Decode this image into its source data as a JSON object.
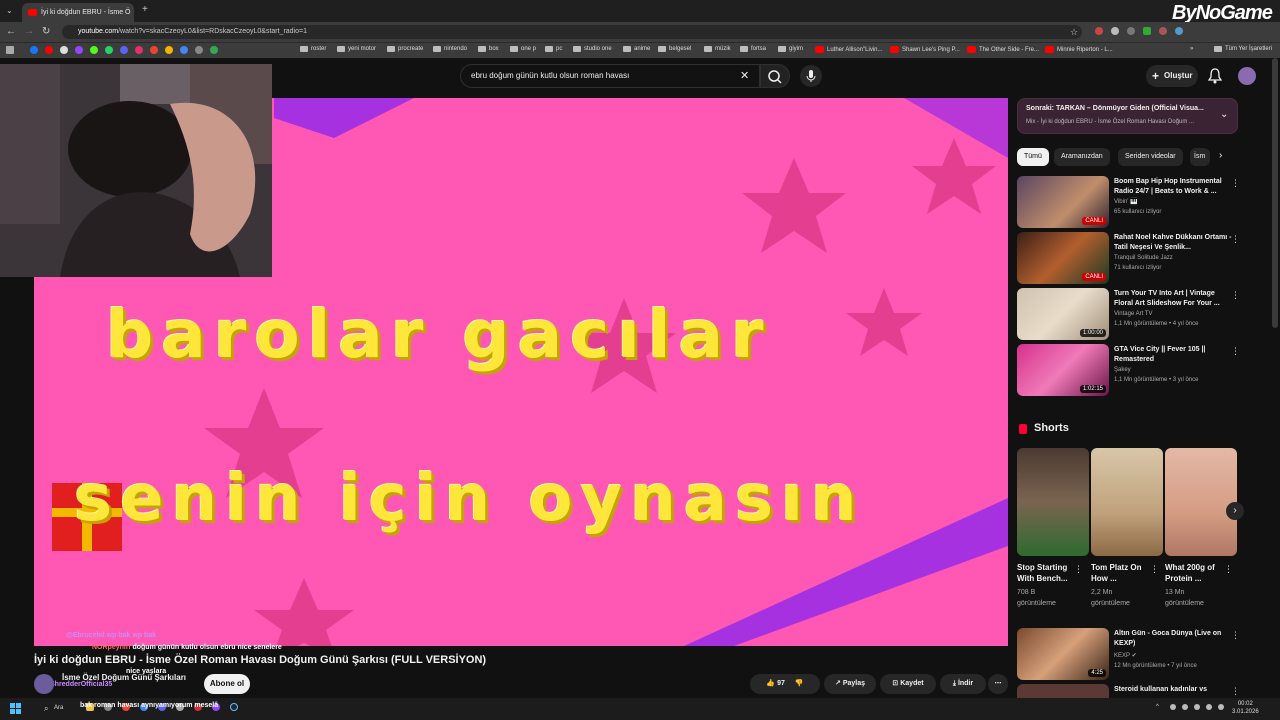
{
  "browser": {
    "tab_title": "İyi ki doğdun EBRU - İsme Ö",
    "url_host": "youtube.com",
    "url_path": "/watch?v=skacCzeoyL0&list=RDskacCzeoyL0&start_radio=1",
    "watermark": "ByNoGame",
    "bookmarks": [
      "roster",
      "yeni motor",
      "procreate",
      "nintendo",
      "box",
      "one p",
      "pc",
      "studio one",
      "anime",
      "belgesel",
      "müzik",
      "fortsa",
      "giyim",
      "Luther Allison\"Livin...",
      "Shawn Lee's Ping P...",
      "The Other Side - Fre...",
      "Minnie Riperton - L..."
    ],
    "bookmarks_all": "Tüm Yer İşaretleri"
  },
  "youtube": {
    "search_query": "ebru doğum günün kutlu olsun roman havası",
    "create_label": "Oluştur",
    "video_text_line1": "barolar gacılar",
    "video_text_line2": "senin için oynasın",
    "video_title": "İyi ki doğdun EBRU - İsme Özel Roman Havası Doğum Günü Şarkısı (FULL VERSİYON)",
    "channel_name": "İsme Özel Doğum Günü Şarkıları",
    "subscribe_label": "Abone ol",
    "likes": "97",
    "share_label": "Paylaş",
    "save_label": "Kaydet",
    "download_label": "İndir"
  },
  "chat": [
    {
      "user": "",
      "text": "@Ebrucehil wp bak wp bak",
      "color": "#c88bff"
    },
    {
      "user": "NORpeyniri",
      "text": "doğum günün kutlu olsun ebru nice senelere",
      "color": "#ff6a6a"
    },
    {
      "user": "",
      "text": "nice yaşlara",
      "color": "#ffffff"
    },
    {
      "user": "ShredderOfficial35",
      "text": "",
      "color": "#c88bff"
    },
    {
      "user": "",
      "text": "bak roman havası aynıyamıyorum meselâ",
      "color": "#ffffff"
    }
  ],
  "sidebar": {
    "next_label": "Sonraki: TARKAN – Dönmüyor Giden (Official Visua...",
    "mix_label": "Mix - İyi ki doğdun EBRU - İsme Özel Roman Havası Doğum ...",
    "chips": [
      "Tümü",
      "Aramanızdan",
      "Seriden videolar",
      "İsm"
    ],
    "recommendations": [
      {
        "title": "Boom Bap Hip Hop Instrumental Radio 24/7 | Beats to Work & ...",
        "channel": "Vibin' 🎹",
        "meta": "65 kullanıcı izliyor",
        "badge": "CANLI",
        "live": true
      },
      {
        "title": "Rahat Noel Kahve Dükkanı Ortamı - Tatil Neşesi Ve Şenlik...",
        "channel": "Tranquil Solitude Jazz",
        "meta": "71 kullanıcı izliyor",
        "badge": "CANLI",
        "live": true
      },
      {
        "title": "Turn Your TV Into Art | Vintage Floral Art Slideshow For Your ...",
        "channel": "Vintage Art TV",
        "meta": "1,1 Mn görüntüleme • 4 yıl önce",
        "badge": "1:00:00",
        "live": false
      },
      {
        "title": "GTA Vice City || Fever 105 || Remastered",
        "channel": "Şakey",
        "meta": "1,1 Mn görüntüleme • 3 yıl önce",
        "badge": "1:02:15",
        "live": false
      }
    ],
    "shorts_heading": "Shorts",
    "shorts": [
      {
        "title": "Stop Starting With Bench...",
        "views": "708 B",
        "label": "görüntüleme"
      },
      {
        "title": "Tom Platz On How ...",
        "views": "2,2 Mn",
        "label": "görüntüleme"
      },
      {
        "title": "What 200g of Protein ...",
        "views": "13 Mn",
        "label": "görüntüleme"
      }
    ],
    "bottom_recs": [
      {
        "title": "Altın Gün - Goca Dünya (Live on KEXP)",
        "channel": "KEXP ✔",
        "meta": "12 Mn görüntüleme • 7 yıl önce",
        "badge": "4:25"
      },
      {
        "title": "Steroid kullanan kadınlar vs",
        "channel": "",
        "meta": "",
        "badge": ""
      }
    ]
  },
  "taskbar": {
    "search_label": "Ara",
    "time": "00:02",
    "date": "3.01.2026"
  }
}
